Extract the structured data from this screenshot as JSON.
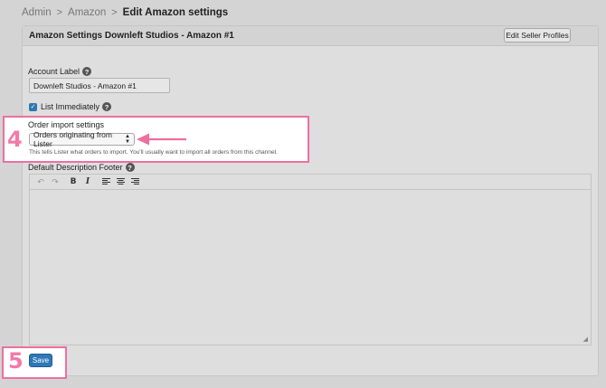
{
  "breadcrumb": {
    "items": [
      "Admin",
      "Amazon"
    ],
    "separator": ">",
    "current": "Edit Amazon settings"
  },
  "panel": {
    "title": "Amazon Settings Downleft Studios - Amazon #1",
    "edit_profiles_label": "Edit Seller Profiles"
  },
  "account_label": {
    "label": "Account Label",
    "value": "Downleft Studios - Amazon #1"
  },
  "list_immediately": {
    "label": "List Immediately",
    "checked": true
  },
  "order_import": {
    "label": "Order import settings",
    "selected": "Orders originating from Lister",
    "hint": "This tells Lister what orders to import. You'll usually want to import all orders from this channel."
  },
  "description_footer": {
    "label": "Default Description Footer"
  },
  "annotations": {
    "step_4": "4",
    "step_5": "5",
    "color": "#ee6fa1"
  },
  "save_label": "Save",
  "icons": {
    "help": "?",
    "check": "✓",
    "resize": "◢"
  },
  "colors": {
    "primary": "#2e78b7",
    "highlight": "#ee6fa1"
  }
}
